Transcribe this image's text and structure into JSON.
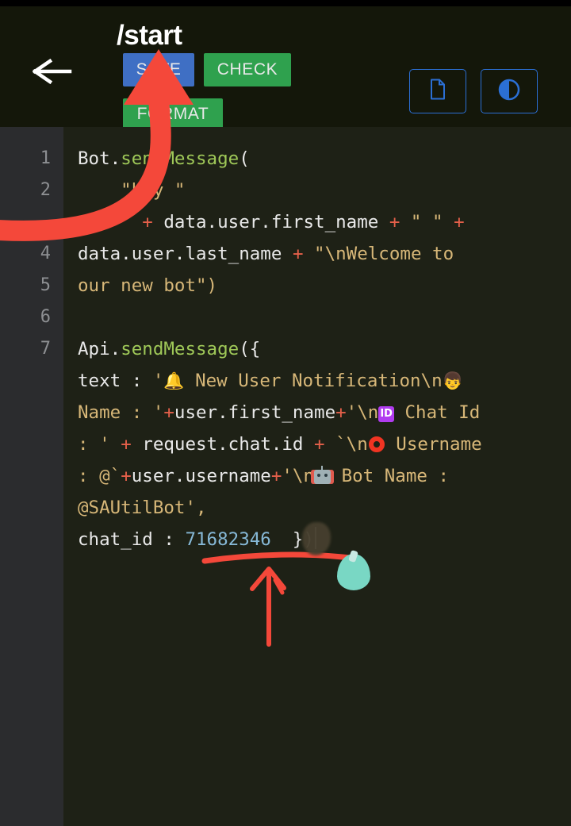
{
  "window": {
    "app_kind": "code-editor",
    "background_color": "#1e2116"
  },
  "header": {
    "title": "/start",
    "back_icon": "back-arrow-icon",
    "background_color": "#14170a",
    "buttons": [
      {
        "id": "save",
        "label": "SAVE",
        "color": "#3f6fc4"
      },
      {
        "id": "check",
        "label": "CHECK",
        "color": "#2fa14e"
      },
      {
        "id": "format",
        "label": "FORMAT",
        "color": "#2fa14e"
      }
    ],
    "icon_buttons": [
      {
        "id": "document",
        "icon": "document-icon",
        "color": "#2b6fd4"
      },
      {
        "id": "contrast",
        "icon": "contrast-icon",
        "color": "#2b6fd4"
      }
    ]
  },
  "editor": {
    "gutter_color": "#2b2c2e",
    "line_numbers": [
      "1",
      "2",
      "",
      "4",
      "5",
      "6",
      "7"
    ],
    "code_text": "Bot.sendMessage(\n    \"hey \"\n      + data.user.first_name + \" \" +\ndata.user.last_name + \"\\nWelcome to\nour new bot\")\n\nApi.sendMessage({\ntext : '🔔 New User Notification\\n👦\nName : '+user.first_name+'\\n🆔 Chat Id\n: ' + request.chat.id + `\\n⭕ Username\n: @`+user.username+'\\n🤖 Bot Name :\n@SAUtilBot',\nchat_id : 71682346 })",
    "lines": [
      {
        "num": "1",
        "segments": [
          {
            "t": "Bot.",
            "c": "plain"
          },
          {
            "t": "sendMessage",
            "c": "fn"
          },
          {
            "t": "(",
            "c": "plain"
          }
        ]
      },
      {
        "num": "2",
        "segments": [
          {
            "t": "    \"hey \"",
            "c": "str"
          }
        ]
      },
      {
        "num": "",
        "segments": [
          {
            "t": "      ",
            "c": "plain"
          },
          {
            "t": "+",
            "c": "op"
          },
          {
            "t": " data.user.first_name ",
            "c": "plain"
          },
          {
            "t": "+",
            "c": "op"
          },
          {
            "t": " \" \" ",
            "c": "str"
          },
          {
            "t": "+",
            "c": "op"
          }
        ]
      },
      {
        "num": "4",
        "segments": [
          {
            "t": "data.user.last_name ",
            "c": "plain"
          },
          {
            "t": "+",
            "c": "op"
          },
          {
            "t": " \"\\nWelcome to",
            "c": "str"
          }
        ]
      },
      {
        "num": "5",
        "segments": [
          {
            "t": "our new bot\")",
            "c": "str"
          }
        ]
      },
      {
        "num": "6",
        "segments": []
      },
      {
        "num": "7",
        "segments": [
          {
            "t": "Api.",
            "c": "plain"
          },
          {
            "t": "sendMessage",
            "c": "fn"
          },
          {
            "t": "({",
            "c": "plain"
          }
        ]
      },
      {
        "num": "",
        "segments": [
          {
            "t": "text : ",
            "c": "plain"
          },
          {
            "t": "'",
            "c": "str"
          },
          {
            "t": "🔔",
            "c": "emoji"
          },
          {
            "t": " New User Notification\\n",
            "c": "str"
          },
          {
            "t": "👦",
            "c": "emoji"
          }
        ]
      },
      {
        "num": "",
        "segments": [
          {
            "t": "Name : ",
            "c": "str"
          },
          {
            "t": "'",
            "c": "str"
          },
          {
            "t": "+",
            "c": "op"
          },
          {
            "t": "user.first_name",
            "c": "plain"
          },
          {
            "t": "+",
            "c": "op"
          },
          {
            "t": "'\\n",
            "c": "str"
          },
          {
            "t": "🆔",
            "c": "idbadge"
          },
          {
            "t": " Chat Id",
            "c": "str"
          }
        ]
      },
      {
        "num": "",
        "segments": [
          {
            "t": ": ",
            "c": "str"
          },
          {
            "t": "' ",
            "c": "str"
          },
          {
            "t": "+",
            "c": "op"
          },
          {
            "t": " request.chat.id ",
            "c": "plain"
          },
          {
            "t": "+",
            "c": "op"
          },
          {
            "t": " `\\n",
            "c": "str"
          },
          {
            "t": "⭕",
            "c": "redring"
          },
          {
            "t": " Username",
            "c": "str"
          }
        ]
      },
      {
        "num": "",
        "segments": [
          {
            "t": ": @`",
            "c": "str"
          },
          {
            "t": "+",
            "c": "op"
          },
          {
            "t": "user.username",
            "c": "plain"
          },
          {
            "t": "+",
            "c": "op"
          },
          {
            "t": "'\\n",
            "c": "str"
          },
          {
            "t": "🤖",
            "c": "robot"
          },
          {
            "t": " Bot Name :",
            "c": "str"
          }
        ]
      },
      {
        "num": "",
        "segments": [
          {
            "t": "@SAUtilBot',",
            "c": "str"
          }
        ]
      },
      {
        "num": "",
        "segments": [
          {
            "t": "chat_id : ",
            "c": "plain"
          },
          {
            "t": "71682346",
            "c": "num"
          },
          {
            "t": "  })",
            "c": "plain"
          }
        ]
      }
    ],
    "chat_id_value": "71682346",
    "bot_username": "@SAUtilBot",
    "caret_visible": true
  },
  "annotations": {
    "arrow_top": {
      "name": "red-curved-arrow-to-save",
      "color": "#f44336",
      "points_at": "SAVE"
    },
    "arrow_bottom": {
      "name": "red-arrow-to-chat-id",
      "color": "#f44336",
      "points_at": "chat_id"
    },
    "underline": {
      "name": "red-underline-chat-id",
      "color": "#f44336"
    },
    "cursor_blob": {
      "name": "teal-touch-cursor",
      "color": "#79d7c4"
    },
    "smudge": {
      "name": "redaction-smudge",
      "color": "#463f2e"
    }
  },
  "colors": {
    "accent_blue": "#3f6fc4",
    "accent_green": "#2fa14e",
    "annotation_red": "#f44336",
    "cursor_teal": "#79d7c4",
    "editor_bg": "#1e2116",
    "gutter_bg": "#2b2c2e",
    "string_token": "#d7b778",
    "function_token": "#9fc858",
    "operator_token": "#e4604a",
    "number_token": "#86b8d6"
  }
}
